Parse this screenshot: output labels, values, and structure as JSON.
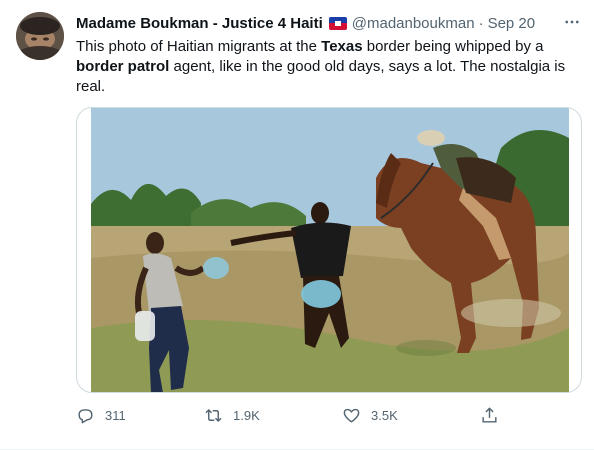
{
  "tweet": {
    "author_name": "Madame Boukman - Justice 4 Haiti",
    "handle": "@madanboukman",
    "separator": "·",
    "date": "Sep 20",
    "text_parts": [
      "This photo of Haitian migrants at the ",
      "Texas",
      " border being whipped by a ",
      "border patrol",
      " agent, like in the good old days, says a lot. The nostalgia is real."
    ]
  },
  "actions": {
    "reply_count": "311",
    "retweet_count": "1.9K",
    "like_count": "3.5K"
  },
  "icons": {
    "reply": "reply-icon",
    "retweet": "retweet-icon",
    "like": "heart-icon",
    "share": "share-icon",
    "more": "more-dots-icon",
    "flag": "haiti-flag-icon"
  },
  "colors": {
    "text": "#0f1419",
    "secondary": "#536471",
    "border": "#cfd9de",
    "flag_blue": "#1a3ea8",
    "flag_red": "#d21034"
  }
}
